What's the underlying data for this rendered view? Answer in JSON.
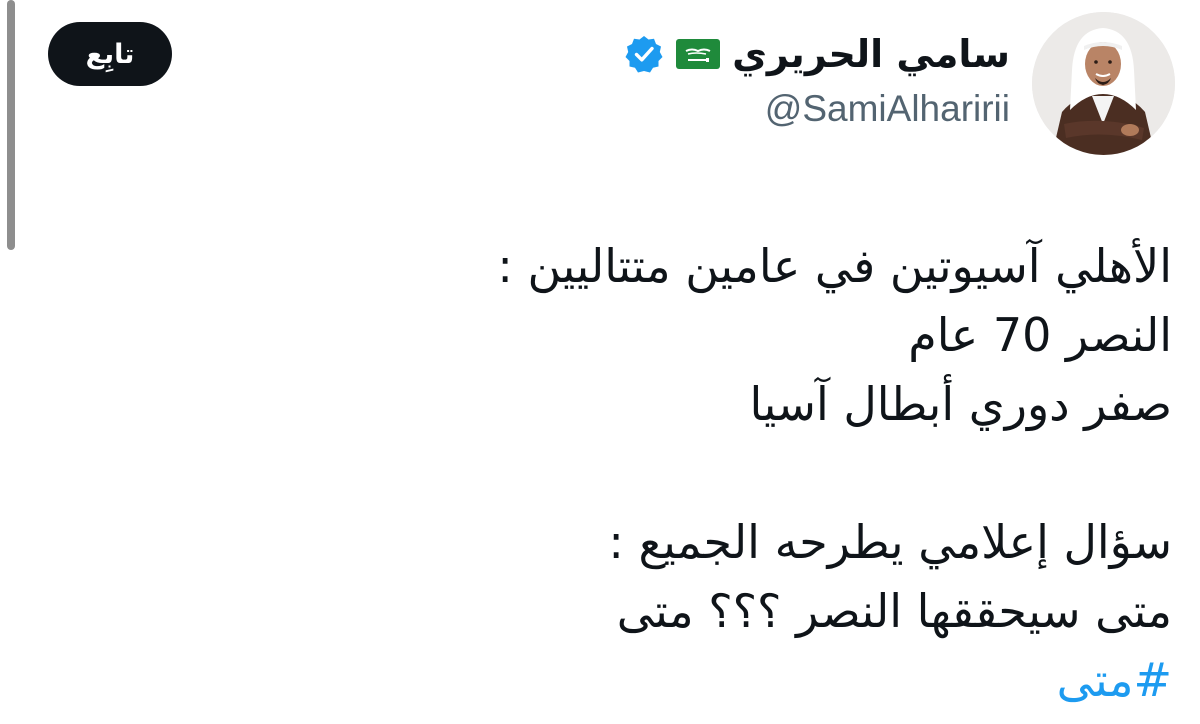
{
  "author": {
    "display_name": "سامي الحريري",
    "handle": "@SamiAlharirii",
    "flag_emoji": "saudi-arabia-flag",
    "verified": true,
    "verified_color": "#1d9bf0"
  },
  "follow_button": {
    "label": "تابِع"
  },
  "tweet": {
    "lines": [
      "الأهلي آسيوتين في عامين متتاليين :",
      "النصر 70 عام",
      "صفر دوري أبطال آسيا",
      "",
      "سؤال إعلامي يطرحه الجميع :",
      "متى سيحققها النصر ؟؟؟ متى"
    ],
    "hashtag": "#متى",
    "hashtag_color": "#1d9bf0"
  }
}
